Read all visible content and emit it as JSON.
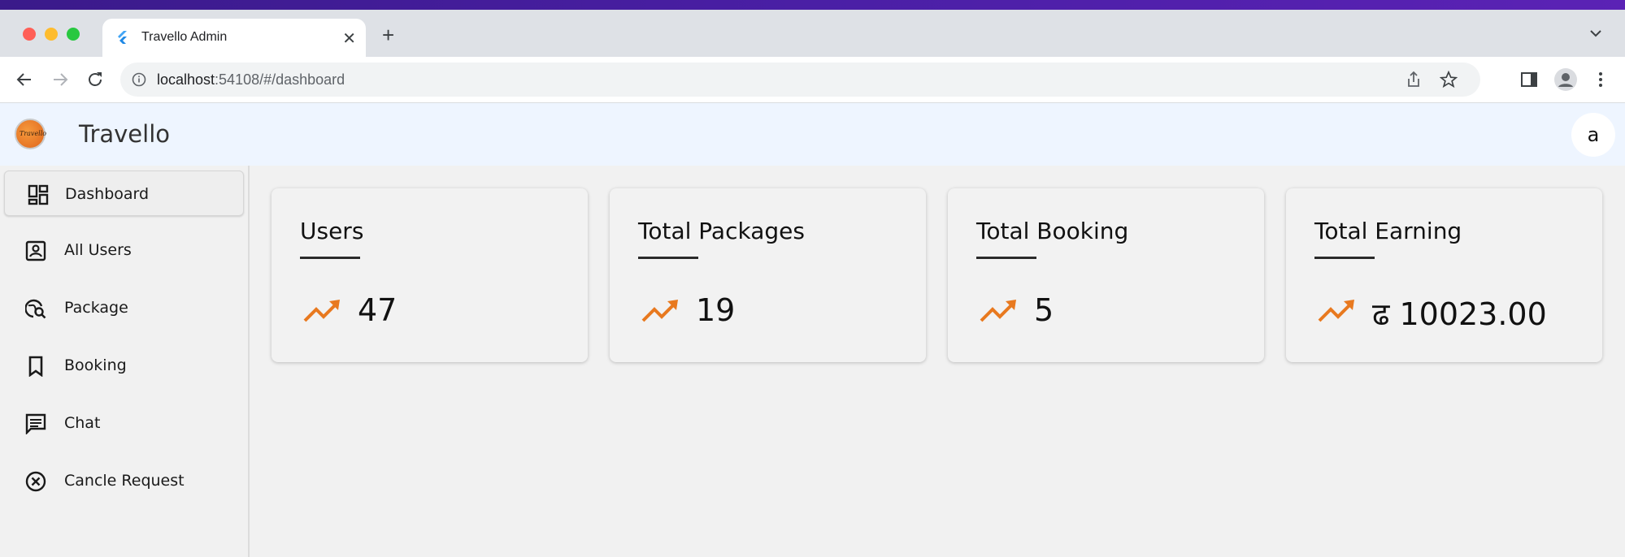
{
  "browser": {
    "tab_title": "Travello Admin",
    "url_host": "localhost",
    "url_path": ":54108/#/dashboard"
  },
  "app": {
    "brand": "Travello",
    "logo_text": "Travello",
    "avatar_initial": "a"
  },
  "sidebar": {
    "items": [
      {
        "label": "Dashboard",
        "icon": "dashboard-icon",
        "active": true
      },
      {
        "label": "All Users",
        "icon": "user-card-icon"
      },
      {
        "label": "Package",
        "icon": "travel-explore-icon"
      },
      {
        "label": "Booking",
        "icon": "bookmark-icon"
      },
      {
        "label": "Chat",
        "icon": "chat-icon"
      },
      {
        "label": "Cancle Request",
        "icon": "cancel-circle-icon"
      }
    ]
  },
  "cards": [
    {
      "title": "Users",
      "value": "47"
    },
    {
      "title": "Total Packages",
      "value": "19"
    },
    {
      "title": "Total Booking",
      "value": "5"
    },
    {
      "title": "Total Earning",
      "value": "ढ 10023.00"
    }
  ],
  "colors": {
    "accent_trend": "#e8791f",
    "appbar_bg": "#eef5ff"
  }
}
